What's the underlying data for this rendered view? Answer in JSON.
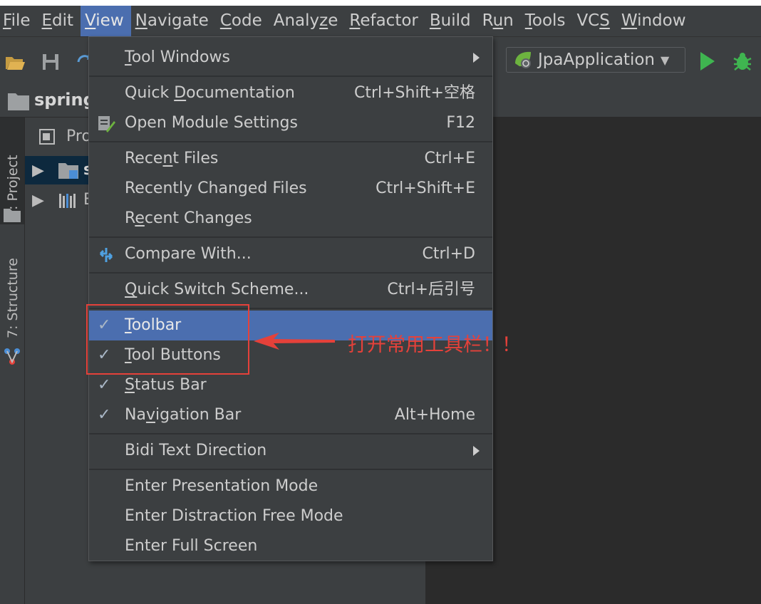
{
  "menubar": {
    "items": [
      {
        "label": "File"
      },
      {
        "label": "Edit"
      },
      {
        "label": "View"
      },
      {
        "label": "Navigate"
      },
      {
        "label": "Code"
      },
      {
        "label": "Analyze"
      },
      {
        "label": "Refactor"
      },
      {
        "label": "Build"
      },
      {
        "label": "Run"
      },
      {
        "label": "Tools"
      },
      {
        "label": "VCS"
      },
      {
        "label": "Window"
      }
    ]
  },
  "toolbar": {
    "run_config": "JpaApplication",
    "icons": [
      "open-folder-icon",
      "save-icon",
      "sync-icon",
      "spring-boot-icon",
      "dropdown-caret-icon",
      "run-icon",
      "debug-icon"
    ]
  },
  "navbar": {
    "crumb": "spring"
  },
  "tool_strip": {
    "project_tab": "1: Project",
    "structure_tab": "7: Structure"
  },
  "project_panel": {
    "header": "Pro",
    "rows": [
      {
        "label": "s"
      },
      {
        "label": "E"
      }
    ]
  },
  "view_menu": {
    "items": [
      {
        "label": "Tool Windows",
        "shortcut": "",
        "submenu": true
      },
      {
        "label": "Quick Documentation",
        "shortcut": "Ctrl+Shift+空格"
      },
      {
        "label": "Open Module Settings",
        "shortcut": "F12"
      },
      {
        "label": "Recent Files",
        "shortcut": "Ctrl+E"
      },
      {
        "label": "Recently Changed Files",
        "shortcut": "Ctrl+Shift+E"
      },
      {
        "label": "Recent Changes",
        "shortcut": ""
      },
      {
        "label": "Compare With...",
        "shortcut": "Ctrl+D"
      },
      {
        "label": "Quick Switch Scheme...",
        "shortcut": "Ctrl+后引号"
      },
      {
        "label": "Toolbar",
        "shortcut": "",
        "checked": true,
        "highlighted": true
      },
      {
        "label": "Tool Buttons",
        "shortcut": "",
        "checked": true
      },
      {
        "label": "Status Bar",
        "shortcut": "",
        "checked": true
      },
      {
        "label": "Navigation Bar",
        "shortcut": "Alt+Home",
        "checked": true
      },
      {
        "label": "Bidi Text Direction",
        "shortcut": "",
        "submenu": true
      },
      {
        "label": "Enter Presentation Mode",
        "shortcut": ""
      },
      {
        "label": "Enter Distraction Free Mode",
        "shortcut": ""
      },
      {
        "label": "Enter Full Screen",
        "shortcut": ""
      }
    ],
    "check_mark": "✓"
  },
  "annotation": {
    "text": "打开常用工具栏！！",
    "color": "#e5413a"
  },
  "colors": {
    "highlight": "#4b6eaf",
    "panel": "#3c3f41",
    "editor": "#2b2b2b"
  }
}
